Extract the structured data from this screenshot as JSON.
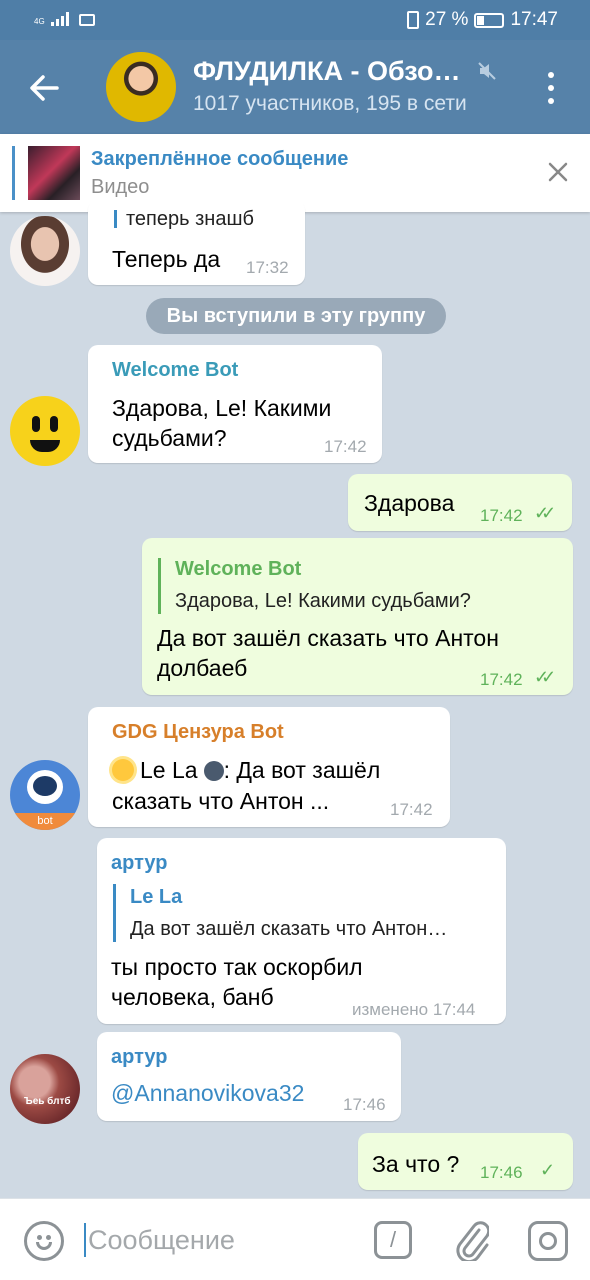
{
  "status_bar": {
    "network": "4G",
    "battery": "27 %",
    "time": "17:47"
  },
  "header": {
    "title": "ФЛУДИЛКА - Обзо…",
    "subtitle": "1017 участников, 195 в сети"
  },
  "pinned": {
    "title": "Закреплённое сообщение",
    "subtitle": "Видео"
  },
  "service_message": "Вы вступили в эту группу",
  "messages": [
    {
      "reply_text": "теперь знашб",
      "text": "Теперь да",
      "time": "17:32"
    },
    {
      "sender": "Welcome Bot",
      "text_line1": "Здарова, Le! Какими",
      "text_line2": "судьбами?",
      "time": "17:42"
    },
    {
      "text": "Здарова",
      "time": "17:42"
    },
    {
      "reply_name": "Welcome Bot",
      "reply_text": "Здарова, Le! Какими судьбами?",
      "text_line1": "Да вот зашёл сказать что Антон",
      "text_line2": "долбаеб",
      "time": "17:42"
    },
    {
      "sender": "GDG Цензура Bot",
      "text_line1_name": "Le La",
      "text_line1_rest": ": Да вот зашёл",
      "text_line2": "сказать что Антон ...",
      "time": "17:42",
      "avatar_label": "bot"
    },
    {
      "sender": "артур",
      "reply_name": "Le La",
      "reply_text": "Да вот зашёл сказать что Антон…",
      "text_line1": "ты просто так оскорбил",
      "text_line2": "человека, банб",
      "time": "изменено 17:44"
    },
    {
      "sender": "артур",
      "text": "@Annanovikova32",
      "time": "17:46",
      "avatar_label": "Ъеь блтб"
    },
    {
      "text": "За что ?",
      "time": "17:46"
    }
  ],
  "input": {
    "placeholder": "Сообщение",
    "value": "",
    "command_label": "/"
  },
  "colors": {
    "header": "#5682a9",
    "link": "#3a8ac4",
    "welcome_bot": "#3a9bb8",
    "gdg_bot": "#d77f2a",
    "outgoing": "#effdde",
    "check": "#5fb25a"
  },
  "icons": [
    "back-arrow-icon",
    "mute-icon",
    "more-vert-icon",
    "close-icon",
    "emoji-icon",
    "bot-command-icon",
    "paperclip-icon",
    "camera-icon",
    "check-icon",
    "double-check-icon"
  ]
}
